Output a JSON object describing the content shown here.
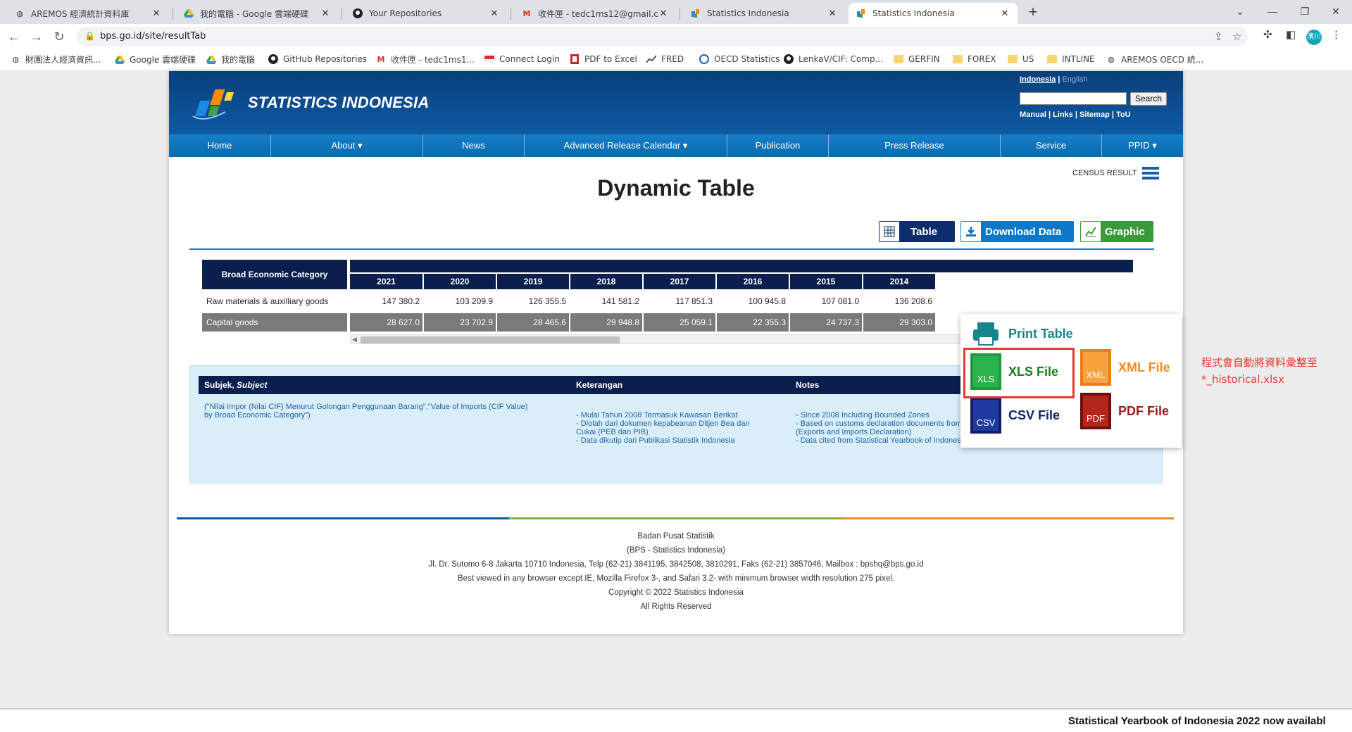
{
  "browser": {
    "tabs": [
      {
        "title": "AREMOS 經濟統計資料庫",
        "icon": "globe-icon"
      },
      {
        "title": "我的電腦 - Google 雲端硬碟",
        "icon": "drive-icon"
      },
      {
        "title": "Your Repositories",
        "icon": "github-icon"
      },
      {
        "title": "收件匣 - tedc1ms12@gmail.co",
        "icon": "gmail-icon"
      },
      {
        "title": "Statistics Indonesia",
        "icon": "bps-icon"
      },
      {
        "title": "Statistics Indonesia",
        "icon": "bps-icon"
      }
    ],
    "url": "bps.go.id/site/resultTab",
    "profile_initials": "濱川",
    "bookmarks": [
      {
        "label": "財團法人經濟資訊...",
        "icon": "globe-icon"
      },
      {
        "label": "Google 雲端硬碟",
        "icon": "drive-icon"
      },
      {
        "label": "我的電腦",
        "icon": "drive-icon"
      },
      {
        "label": "GitHub Repositories",
        "icon": "github-icon"
      },
      {
        "label": "收件匣 - tedc1ms1...",
        "icon": "gmail-icon"
      },
      {
        "label": "Connect Login",
        "icon": "flag-icon"
      },
      {
        "label": "PDF to Excel",
        "icon": "pdf-excel-icon"
      },
      {
        "label": "FRED",
        "icon": "chart-icon"
      },
      {
        "label": "OECD Statistics",
        "icon": "oecd-icon"
      },
      {
        "label": "LenkaV/CIF: Comp...",
        "icon": "github-icon"
      },
      {
        "label": "GERFIN",
        "icon": "folder-icon"
      },
      {
        "label": "FOREX",
        "icon": "folder-icon"
      },
      {
        "label": "US",
        "icon": "folder-icon"
      },
      {
        "label": "INTLINE",
        "icon": "folder-icon"
      },
      {
        "label": "AREMOS OECD 統...",
        "icon": "globe-icon"
      }
    ]
  },
  "site": {
    "logo_text": "STATISTICS INDONESIA",
    "lang_active": "Indonesia",
    "lang_sep": " | ",
    "lang_other": "English",
    "search_button": "Search",
    "header_links": "Manual | Links | Sitemap | ToU",
    "nav": [
      "Home",
      "About ▾",
      "News",
      "Advanced Release Calendar ▾",
      "Publication",
      "Press Release",
      "Service",
      "PPID ▾"
    ],
    "census_label": "CENSUS RESULT"
  },
  "main": {
    "title": "Dynamic Table",
    "buttons": {
      "table": "Table",
      "download": "Download Data",
      "graphic": "Graphic"
    },
    "table": {
      "category_header": "Broad Economic Category",
      "years": [
        "2021",
        "2020",
        "2019",
        "2018",
        "2017",
        "2016",
        "2015",
        "2014"
      ],
      "rows": [
        {
          "label": "Raw materials & auxilliary goods",
          "values": [
            "147 380.2",
            "103 209.9",
            "126 355.5",
            "141 581.2",
            "117 851.3",
            "100 945.8",
            "107 081.0",
            "136 208.6"
          ]
        },
        {
          "label": "Capital goods",
          "values": [
            "28 627.0",
            "23 702.9",
            "28 465.6",
            "29 948.8",
            "25 059.1",
            "22 355.3",
            "24 737.3",
            "29 303.0"
          ]
        }
      ]
    },
    "notes": {
      "headers": {
        "subject": "Subjek, ",
        "subject_italic": "Subject",
        "keterangan": "Keterangan",
        "notes": "Notes"
      },
      "subject_text_1": "(\"Nilai Impor (Nilai CIF) Menurut Golongan Penggunaan Barang\",\"Value of Imports (CIF Value)",
      "subject_text_2": "by Broad Economic Category\")",
      "keterangan": [
        "- Mulai Tahun 2008 Termasuk Kawasan Berikat",
        "- Diolah dari dokumen kepabeanan Ditjen Bea dan",
        "Cukai (PEB dan PIB)",
        "- Data dikutip dari Publikasi Statistik Indonesia"
      ],
      "notes": [
        "- Since 2008 Including Bounded Zones",
        "- Based on customs declaration documents from Directorate General of Customs and Excise",
        "(Exports and Imports Declaration)",
        "- Data cited from Statistical Yearbook of Indonesia"
      ]
    },
    "dropdown": {
      "print": "Print Table",
      "xls": "XLS File",
      "xls_badge": "XLS",
      "xml": "XML File",
      "xml_badge": "XML",
      "csv": "CSV File",
      "csv_badge": "CSV",
      "pdf": "PDF File",
      "pdf_badge": "PDF"
    },
    "annotation": [
      "程式會自動將資料彙整至",
      "*_historical.xlsx"
    ]
  },
  "footer": {
    "lines": [
      "Badan Pusat Statistik",
      "(BPS - Statistics Indonesia)",
      "Jl. Dr. Sutomo 6-8 Jakarta 10710 Indonesia, Telp (62-21) 3841195, 3842508, 3810291, Faks (62-21) 3857046, Mailbox : bpshq@bps.go.id",
      "Best viewed in any browser except IE, Mozilla Firefox 3-, and Safari 3.2- with minimum browser width resolution 275 pixel.",
      "Copyright © 2022 Statistics Indonesia",
      "All Rights Reserved"
    ],
    "ticker": "Statistical Yearbook of Indonesia 2022 now availabl"
  },
  "colors": {
    "navy": "#0b1f4f",
    "blue": "#0e78c8",
    "green": "#3a9a3a",
    "highlight": "#e53935"
  }
}
